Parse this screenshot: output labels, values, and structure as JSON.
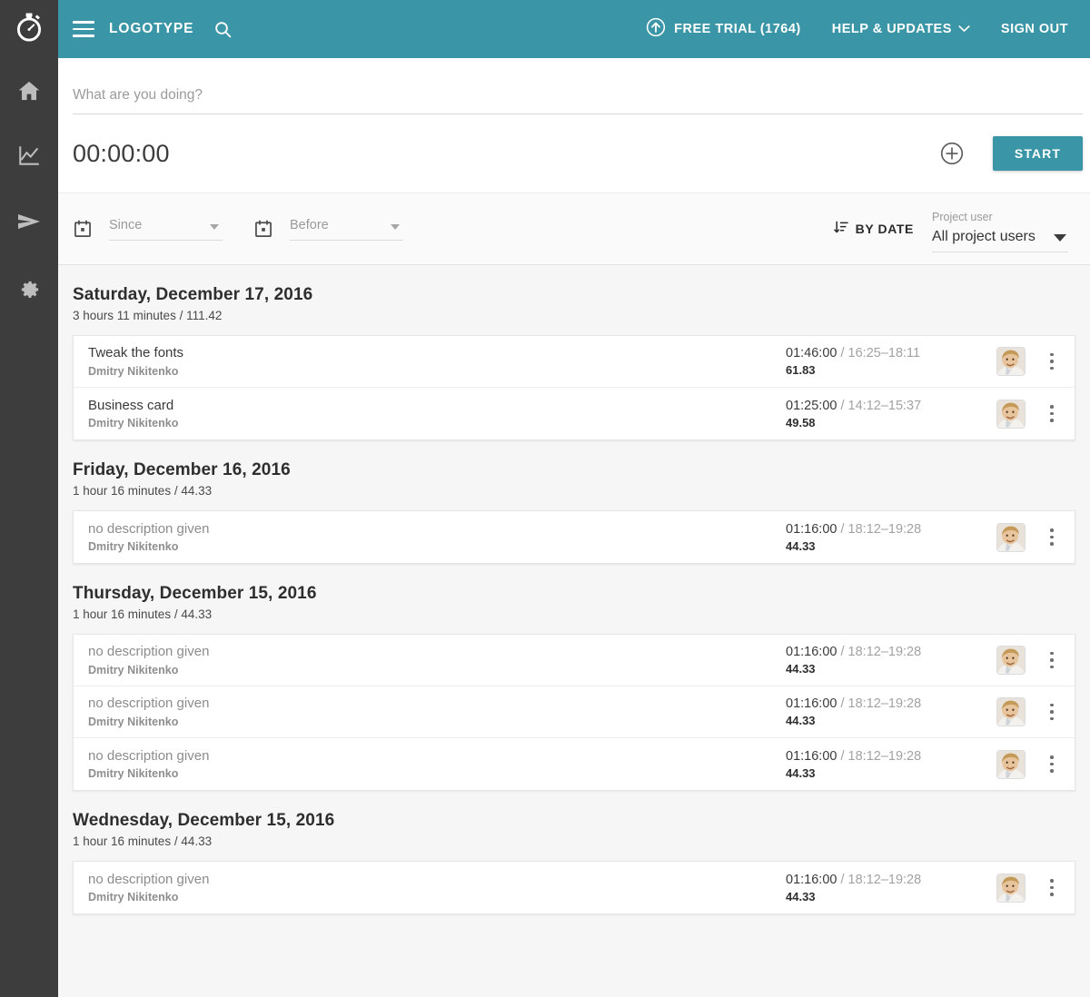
{
  "app": {
    "logo_icon": "stopwatch-icon",
    "brand": "LOGOTYPE",
    "accent_color": "#3a95a6",
    "sidebar_color": "#3d3d3d"
  },
  "sidebar": {
    "items": [
      {
        "icon": "home-icon",
        "name": "home"
      },
      {
        "icon": "chart-line-icon",
        "name": "reports"
      },
      {
        "icon": "send-icon",
        "name": "send"
      },
      {
        "icon": "gear-icon",
        "name": "settings"
      }
    ]
  },
  "header": {
    "menu_icon": "hamburger-icon",
    "search_icon": "search-icon",
    "trial_label": "FREE TRIAL (1764)",
    "trial_icon": "arrow-up-circle-icon",
    "help_label": "HELP & UPDATES",
    "help_caret_icon": "chevron-down-icon",
    "sign_out_label": "SIGN OUT"
  },
  "timer": {
    "task_placeholder": "What are you doing?",
    "task_value": "",
    "elapsed": "00:00:00",
    "add_icon": "plus-circle-icon",
    "start_label": "START"
  },
  "filters": {
    "since": {
      "icon": "calendar-icon",
      "placeholder": "Since",
      "value": "Since"
    },
    "before": {
      "icon": "calendar-icon",
      "placeholder": "Before",
      "value": "Before"
    },
    "sort": {
      "icon": "sort-descending-icon",
      "label": "BY DATE"
    },
    "project_user": {
      "label": "Project user",
      "value": "All project users",
      "caret_icon": "caret-down-icon"
    }
  },
  "days": [
    {
      "title": "Saturday, December 17, 2016",
      "summary": "3 hours 11 minutes / 111.42",
      "entries": [
        {
          "description": "Tweak the fonts",
          "empty": false,
          "user": "Dmitry Nikitenko",
          "duration": "01:46:00",
          "range": "/ 16:25–18:11",
          "amount": "61.83",
          "avatar": "user-avatar",
          "menu_icon": "kebab-menu-icon"
        },
        {
          "description": "Business card",
          "empty": false,
          "user": "Dmitry Nikitenko",
          "duration": "01:25:00",
          "range": "/ 14:12–15:37",
          "amount": "49.58",
          "avatar": "user-avatar",
          "menu_icon": "kebab-menu-icon"
        }
      ]
    },
    {
      "title": "Friday, December 16, 2016",
      "summary": "1 hour 16 minutes / 44.33",
      "entries": [
        {
          "description": "no description given",
          "empty": true,
          "user": "Dmitry Nikitenko",
          "duration": "01:16:00",
          "range": "/ 18:12–19:28",
          "amount": "44.33",
          "avatar": "user-avatar",
          "menu_icon": "kebab-menu-icon"
        }
      ]
    },
    {
      "title": "Thursday, December 15, 2016",
      "summary": "1 hour 16 minutes / 44.33",
      "entries": [
        {
          "description": "no description given",
          "empty": true,
          "user": "Dmitry Nikitenko",
          "duration": "01:16:00",
          "range": "/ 18:12–19:28",
          "amount": "44.33",
          "avatar": "user-avatar",
          "menu_icon": "kebab-menu-icon"
        },
        {
          "description": "no description given",
          "empty": true,
          "user": "Dmitry Nikitenko",
          "duration": "01:16:00",
          "range": "/ 18:12–19:28",
          "amount": "44.33",
          "avatar": "user-avatar",
          "menu_icon": "kebab-menu-icon"
        },
        {
          "description": "no description given",
          "empty": true,
          "user": "Dmitry Nikitenko",
          "duration": "01:16:00",
          "range": "/ 18:12–19:28",
          "amount": "44.33",
          "avatar": "user-avatar",
          "menu_icon": "kebab-menu-icon"
        }
      ]
    },
    {
      "title": "Wednesday, December 15, 2016",
      "summary": "1 hour 16 minutes / 44.33",
      "entries": [
        {
          "description": "no description given",
          "empty": true,
          "user": "Dmitry Nikitenko",
          "duration": "01:16:00",
          "range": "/ 18:12–19:28",
          "amount": "44.33",
          "avatar": "user-avatar",
          "menu_icon": "kebab-menu-icon"
        }
      ]
    }
  ]
}
